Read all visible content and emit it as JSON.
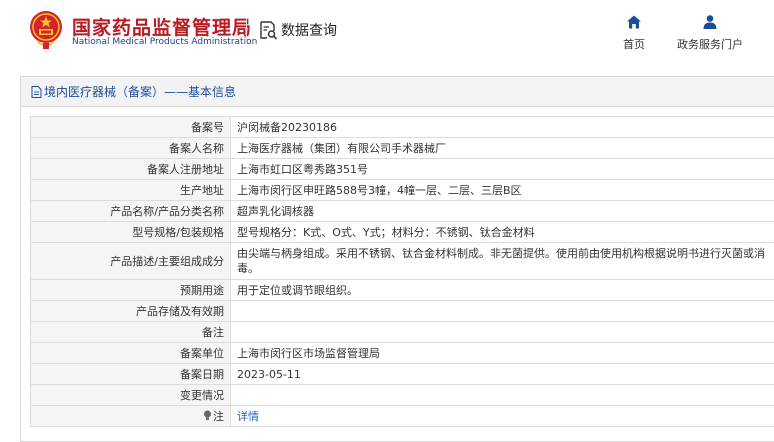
{
  "header": {
    "brand_cn": "国家药品监督管理局",
    "brand_en": "National Medical Products Administration",
    "query_label": "数据查询",
    "nav": [
      {
        "label": "首页",
        "icon": "home-icon"
      },
      {
        "label": "政务服务门户",
        "icon": "user-icon"
      }
    ]
  },
  "panel": {
    "title": "境内医疗器械（备案）——基本信息"
  },
  "rows": [
    {
      "label": "备案号",
      "value": "沪闵械备20230186"
    },
    {
      "label": "备案人名称",
      "value": "上海医疗器械（集团）有限公司手术器械厂"
    },
    {
      "label": "备案人注册地址",
      "value": "上海市虹口区粤秀路351号"
    },
    {
      "label": "生产地址",
      "value": "上海市闵行区申旺路588号3幢，4幢一层、二层、三层B区"
    },
    {
      "label": "产品名称/产品分类名称",
      "value": "超声乳化调核器"
    },
    {
      "label": "型号规格/包装规格",
      "value": "型号规格分：K式、O式、Y式；材料分：不锈钢、钛合金材料"
    },
    {
      "label": "产品描述/主要组成成分",
      "value": "由尖端与柄身组成。采用不锈钢、钛合金材料制成。非无菌提供。使用前由使用机构根据说明书进行灭菌或消毒。"
    },
    {
      "label": "预期用途",
      "value": "用于定位或调节眼组织。"
    },
    {
      "label": "产品存储及有效期",
      "value": ""
    },
    {
      "label": "备注",
      "value": ""
    },
    {
      "label": "备案单位",
      "value": "上海市闵行区市场监督管理局"
    },
    {
      "label": "备案日期",
      "value": "2023-05-11"
    },
    {
      "label": "变更情况",
      "value": ""
    },
    {
      "label": "注",
      "value": "详情"
    }
  ],
  "colors": {
    "brand_red": "#b81b22",
    "brand_blue": "#1f3f8f",
    "link": "#2469c7"
  }
}
